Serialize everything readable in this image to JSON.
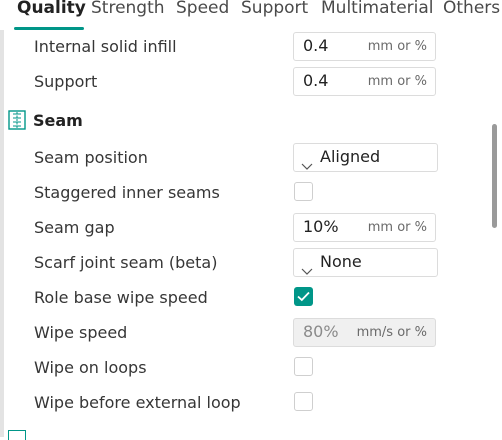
{
  "tabs": [
    {
      "label": "Quality",
      "active": true
    },
    {
      "label": "Strength",
      "active": false
    },
    {
      "label": "Speed",
      "active": false
    },
    {
      "label": "Support",
      "active": false
    },
    {
      "label": "Multimaterial",
      "active": false
    },
    {
      "label": "Others",
      "active": false
    }
  ],
  "accent_color": "#009688",
  "rows": {
    "internal_solid_infill": {
      "label": "Internal solid infill",
      "value": "0.4",
      "unit": "mm or %"
    },
    "support": {
      "label": "Support",
      "value": "0.4",
      "unit": "mm or %"
    },
    "seam_section": {
      "label": "Seam",
      "icon": "seam-icon"
    },
    "seam_position": {
      "label": "Seam position",
      "value": "Aligned"
    },
    "staggered_inner_seams": {
      "label": "Staggered inner seams",
      "checked": false
    },
    "seam_gap": {
      "label": "Seam gap",
      "value": "10%",
      "unit": "mm or %"
    },
    "scarf_joint_seam": {
      "label": "Scarf joint seam (beta)",
      "value": "None"
    },
    "role_base_wipe_speed": {
      "label": "Role base wipe speed",
      "checked": true
    },
    "wipe_speed": {
      "label": "Wipe speed",
      "value": "80%",
      "unit": "mm/s or %",
      "disabled": true
    },
    "wipe_on_loops": {
      "label": "Wipe on loops",
      "checked": false
    },
    "wipe_before_external_loop": {
      "label": "Wipe before external loop",
      "checked": false
    }
  }
}
